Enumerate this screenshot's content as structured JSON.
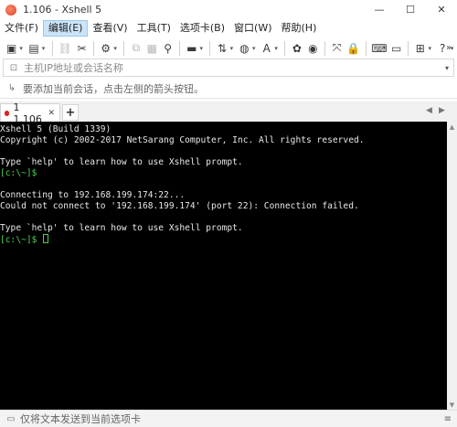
{
  "window": {
    "title": "1.106 - Xshell 5",
    "minimize_glyph": "—",
    "maximize_glyph": "☐",
    "close_glyph": "✕"
  },
  "menu": {
    "items": [
      {
        "label": "文件(F)",
        "active": false
      },
      {
        "label": "编辑(E)",
        "active": true
      },
      {
        "label": "查看(V)",
        "active": false
      },
      {
        "label": "工具(T)",
        "active": false
      },
      {
        "label": "选项卡(B)",
        "active": false
      },
      {
        "label": "窗口(W)",
        "active": false
      },
      {
        "label": "帮助(H)",
        "active": false
      }
    ]
  },
  "toolbar": {
    "icons": [
      {
        "name": "new-session-icon",
        "glyph": "▣",
        "dropdown": true
      },
      {
        "name": "open-folder-icon",
        "glyph": "▤",
        "dropdown": true
      },
      {
        "name": "sep"
      },
      {
        "name": "link-icon",
        "glyph": "⛓",
        "dim": true
      },
      {
        "name": "disconnect-icon",
        "glyph": "✂",
        "dim": false
      },
      {
        "name": "sep"
      },
      {
        "name": "properties-icon",
        "glyph": "⚙",
        "dropdown": true
      },
      {
        "name": "sep"
      },
      {
        "name": "copy-icon",
        "glyph": "⧉",
        "dim": true
      },
      {
        "name": "paste-icon",
        "glyph": "▦",
        "dim": true
      },
      {
        "name": "find-icon",
        "glyph": "⚲"
      },
      {
        "name": "sep"
      },
      {
        "name": "print-icon",
        "glyph": "▬",
        "dropdown": true
      },
      {
        "name": "sep"
      },
      {
        "name": "transfer-icon",
        "glyph": "⇅",
        "dropdown": true
      },
      {
        "name": "globe-icon",
        "glyph": "◍",
        "dropdown": true
      },
      {
        "name": "font-icon",
        "glyph": "A",
        "dropdown": true
      },
      {
        "name": "sep"
      },
      {
        "name": "xftp-icon",
        "glyph": "✿"
      },
      {
        "name": "script-icon",
        "glyph": "◉"
      },
      {
        "name": "sep"
      },
      {
        "name": "fullscreen-icon",
        "glyph": "⤧"
      },
      {
        "name": "lock-icon",
        "glyph": "🔒"
      },
      {
        "name": "sep"
      },
      {
        "name": "keyboard-icon",
        "glyph": "⌨"
      },
      {
        "name": "compose-icon",
        "glyph": "▭"
      },
      {
        "name": "sep"
      },
      {
        "name": "add-icon",
        "glyph": "⊞",
        "dropdown": true
      },
      {
        "name": "help-icon",
        "glyph": "?",
        "dropdown": true
      }
    ],
    "overflow_glyph": "»"
  },
  "address": {
    "placeholder": "主机IP地址或会话名称",
    "value": "",
    "lock_glyph": "⊡",
    "dropdown_glyph": "▾"
  },
  "hint": {
    "text": "要添加当前会话，点击左侧的箭头按钮。",
    "icon_glyph": "↳"
  },
  "tabs": {
    "items": [
      {
        "label": "1 1.106",
        "close_glyph": "✕"
      }
    ],
    "add_glyph": "+",
    "nav_prev_glyph": "◀",
    "nav_next_glyph": "▶"
  },
  "terminal": {
    "lines": [
      {
        "text": "Xshell 5 (Build 1339)",
        "prompt": false
      },
      {
        "text": "Copyright (c) 2002-2017 NetSarang Computer, Inc. All rights reserved.",
        "prompt": false
      },
      {
        "text": "",
        "prompt": false
      },
      {
        "text": "Type `help' to learn how to use Xshell prompt.",
        "prompt": false
      },
      {
        "text": "[c:\\~]$ ",
        "prompt": true
      },
      {
        "text": "",
        "prompt": false
      },
      {
        "text": "Connecting to 192.168.199.174:22...",
        "prompt": false
      },
      {
        "text": "Could not connect to '192.168.199.174' (port 22): Connection failed.",
        "prompt": false
      },
      {
        "text": "",
        "prompt": false
      },
      {
        "text": "Type `help' to learn how to use Xshell prompt.",
        "prompt": false
      },
      {
        "text": "[c:\\~]$ ",
        "prompt": true,
        "cursor": true
      }
    ]
  },
  "scrollbar": {
    "up_glyph": "▲",
    "down_glyph": "▼"
  },
  "status": {
    "text": "仅将文本发送到当前选项卡",
    "icon_glyph": "▭",
    "menu_glyph": "≡"
  }
}
